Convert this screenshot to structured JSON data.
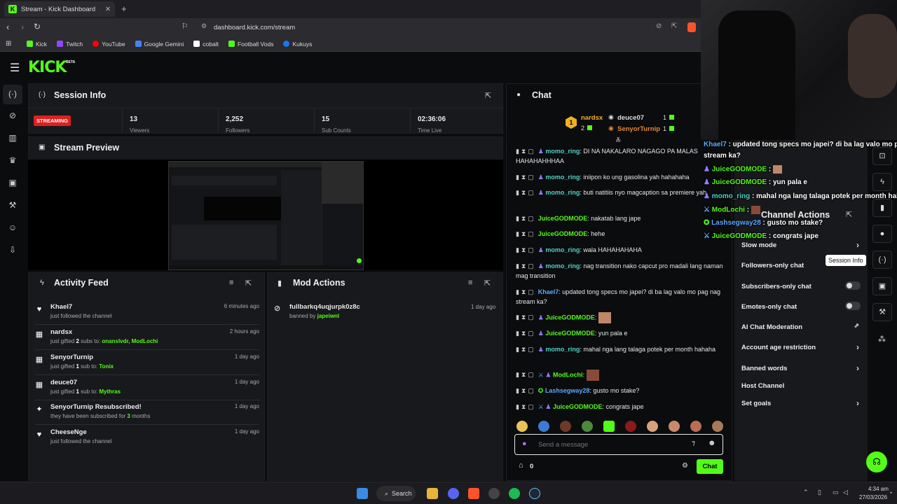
{
  "browser": {
    "tab_title": "Stream - Kick Dashboard",
    "url": "dashboard.kick.com/stream",
    "bookmarks": [
      "Kick",
      "Twitch",
      "YouTube",
      "Google Gemini",
      "cobalt",
      "Football Vods",
      "Kukuys"
    ],
    "bookmark_colors": [
      "#53fc18",
      "#9146ff",
      "#ff0000",
      "#4285f4",
      "#ffffff",
      "#53fc18",
      "#1877f2"
    ]
  },
  "app": {
    "logo": "KICK",
    "logo_sup": "BETA"
  },
  "session": {
    "title": "Session Info",
    "status": "STREAMING",
    "stats": [
      {
        "value": "13",
        "label": "Viewers"
      },
      {
        "value": "2,252",
        "label": "Followers"
      },
      {
        "value": "15",
        "label": "Sub Counts"
      },
      {
        "value": "02:36:06",
        "label": "Time Live"
      }
    ]
  },
  "preview": {
    "title": "Stream Preview"
  },
  "activity": {
    "title": "Activity Feed",
    "items": [
      {
        "icon": "heart-icon",
        "name": "Khael7",
        "desc": "just followed the channel",
        "time": "6 minutes ago"
      },
      {
        "icon": "gift-icon",
        "name": "nardsx",
        "desc_a": "just gifted ",
        "desc_b": "2",
        "desc_c": " subs to: ",
        "desc_d": "onanslvdr, ModLochi",
        "time": "2 hours ago"
      },
      {
        "icon": "gift-icon",
        "name": "SenyorTurnip",
        "desc_a": "just gifted ",
        "desc_b": "1",
        "desc_c": " sub to: ",
        "desc_d": "Tonix",
        "time": "1 day ago"
      },
      {
        "icon": "gift-icon",
        "name": "deuce07",
        "desc_a": "just gifted ",
        "desc_b": "1",
        "desc_c": " sub to: ",
        "desc_d": "Mythras",
        "time": "1 day ago"
      },
      {
        "icon": "sparkle-icon",
        "name": "SenyorTurnip Resubscribed!",
        "desc_a": "they have been subscribed for ",
        "desc_b": "3",
        "desc_c": " months",
        "time": "1 day ago"
      },
      {
        "icon": "heart-icon",
        "name": "CheeseNge",
        "desc": "just followed the channel",
        "time": "1 day ago"
      }
    ]
  },
  "mod": {
    "title": "Mod Actions",
    "items": [
      {
        "name": "fullbarkq4uqjurpk0z8c",
        "desc": "banned by ",
        "by": "japeiwnl",
        "time": "1 day ago"
      }
    ]
  },
  "chat": {
    "title": "Chat",
    "top": [
      {
        "rank": "1",
        "name": "nardsx",
        "count": "2"
      },
      {
        "name": "deuce07",
        "count": "1"
      },
      {
        "name": "SenyorTurnip",
        "count": "1"
      }
    ],
    "messages": [
      {
        "user": "momo_ring",
        "color": "teal",
        "text": ": DI NA NAKALARO NAGAGO PA MALAS HAHAHAHHHAA"
      },
      {
        "user": "momo_ring",
        "color": "teal",
        "text": ": iniipon ko ung gasolina yah hahahaha"
      },
      {
        "user": "momo_ring",
        "color": "teal",
        "text": ": buti natitiis nyo magcaption sa premiere yah"
      },
      {
        "user": "JuiceGODMODE",
        "color": "green",
        "text": ": nakatab lang jape"
      },
      {
        "user": "JuiceGODMODE",
        "color": "green",
        "text": ": hehe"
      },
      {
        "user": "momo_ring",
        "color": "teal",
        "text": ": wala HAHAHAHAHA"
      },
      {
        "user": "momo_ring",
        "color": "teal",
        "text": ": nag transition nako capcut pro madali lang naman mag transition"
      },
      {
        "user": "Khael7",
        "color": "blue",
        "text": ": updated tong specs mo japei? di ba lag valo mo pag nag stream ka?"
      },
      {
        "user": "JuiceGODMODE",
        "color": "green",
        "text": ":"
      },
      {
        "user": "JuiceGODMODE",
        "color": "green",
        "text": ": yun pala e"
      },
      {
        "user": "momo_ring",
        "color": "teal",
        "text": ": mahal nga lang talaga potek per month hahaha"
      },
      {
        "user": "ModLochi",
        "color": "green",
        "text": ":"
      },
      {
        "user": "Lashsegway28",
        "color": "blue",
        "text": ": gusto mo stake?"
      },
      {
        "user": "JuiceGODMODE",
        "color": "green",
        "text": ": congrats jape"
      }
    ],
    "placeholder": "Send a message",
    "points": "0",
    "send": "Chat"
  },
  "overlay": {
    "lines": [
      {
        "user": "Khael7",
        "text": " : updated tong specs mo japei? di ba lag valo mo pa"
      },
      {
        "user": "",
        "text": "stream ka?"
      },
      {
        "user": "JuiceGODMODE",
        "text": " :"
      },
      {
        "user": "JuiceGODMODE",
        "text": " : yun pala e"
      },
      {
        "user": "momo_ring",
        "text": " : mahal nga lang talaga potek per month hah"
      },
      {
        "user": "ModLochi",
        "text": " :"
      },
      {
        "user": "Lashsegway28",
        "text": " : gusto mo stake?"
      },
      {
        "user": "JuiceGODMODE",
        "text": " : congrats jape"
      }
    ]
  },
  "channel_actions": {
    "title": "Channel Actions",
    "items": [
      "Slow mode",
      "Followers-only chat",
      "Subscribers-only chat",
      "Emotes-only chat",
      "AI Chat Moderation",
      "Account age restriction",
      "Banned words",
      "Host Channel",
      "Set goals"
    ],
    "tooltip": "Session Info"
  },
  "taskbar": {
    "search": "Search",
    "time": "4:34 am",
    "date": "27/03/2026"
  }
}
